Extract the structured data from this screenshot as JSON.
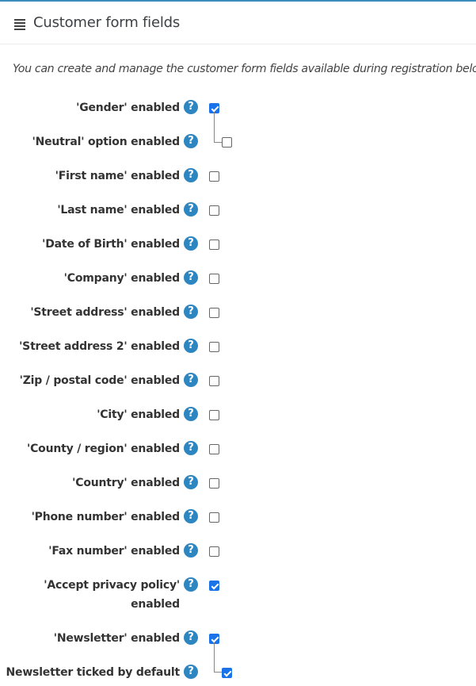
{
  "header": {
    "title": "Customer form fields",
    "icon": "menu-lines-icon"
  },
  "description": "You can create and manage the customer form fields available during registration below.",
  "help_glyph": "?",
  "fields": [
    {
      "label": "'Gender' enabled",
      "checked": true
    },
    {
      "label": "'Neutral' option enabled",
      "checked": false,
      "sub": true
    },
    {
      "label": "'First name' enabled",
      "checked": false
    },
    {
      "label": "'Last name' enabled",
      "checked": false
    },
    {
      "label": "'Date of Birth' enabled",
      "checked": false
    },
    {
      "label": "'Company' enabled",
      "checked": false
    },
    {
      "label": "'Street address' enabled",
      "checked": false
    },
    {
      "label": "'Street address 2' enabled",
      "checked": false
    },
    {
      "label": "'Zip / postal code' enabled",
      "checked": false
    },
    {
      "label": "'City' enabled",
      "checked": false
    },
    {
      "label": "'County / region' enabled",
      "checked": false
    },
    {
      "label": "'Country' enabled",
      "checked": false
    },
    {
      "label": "'Phone number' enabled",
      "checked": false
    },
    {
      "label": "'Fax number' enabled",
      "checked": false
    },
    {
      "label_line1": "'Accept privacy policy'",
      "label_line2": "enabled",
      "checked": true
    },
    {
      "label": "'Newsletter' enabled",
      "checked": true
    },
    {
      "label": "Newsletter ticked by default",
      "checked": true,
      "sub": true
    }
  ]
}
